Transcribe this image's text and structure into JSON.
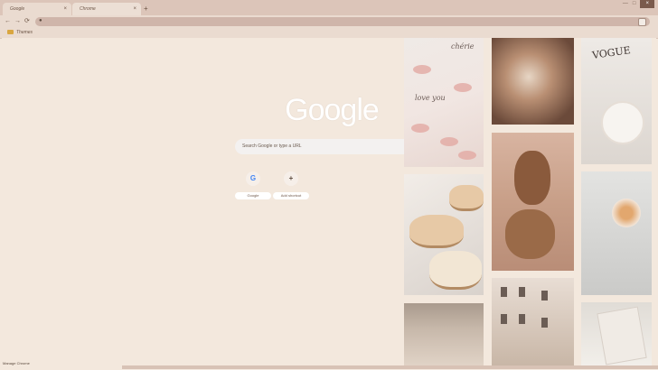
{
  "tabs": [
    {
      "title": "Google",
      "close": "×"
    },
    {
      "title": "Chrome",
      "close": "×"
    }
  ],
  "new_tab_symbol": "+",
  "window_controls": [
    "—",
    "□",
    "×"
  ],
  "nav": {
    "back": "←",
    "forward": "→",
    "reload": "⟳"
  },
  "omnibox": {
    "search_icon": "search-icon"
  },
  "bookmarks": [
    {
      "label": "Themes"
    }
  ],
  "logo": "Google",
  "search": {
    "placeholder": "Search Google or type a URL"
  },
  "shortcuts": [
    {
      "label": "Google",
      "icon_glyph": "G",
      "icon_color": "#4285f4"
    },
    {
      "label": "Add shortcut",
      "icon_glyph": "+",
      "icon_color": "#5b4a3e"
    }
  ],
  "photos": {
    "p1_text_1": "love you",
    "p1_text_2": "chérie",
    "p3_text": "VOGUE"
  },
  "customize_label": "Manage Chrome"
}
